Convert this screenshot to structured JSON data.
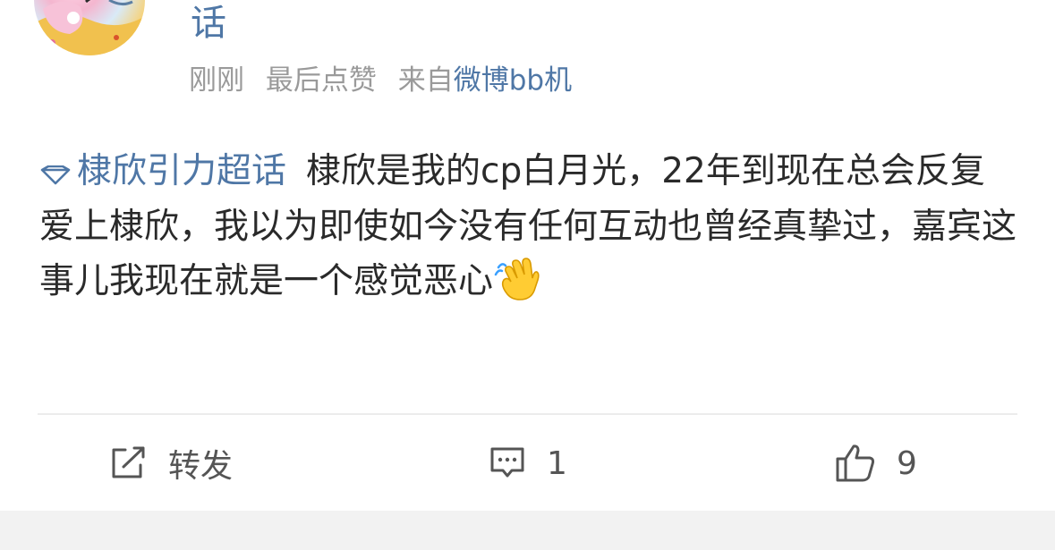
{
  "post": {
    "author": "话",
    "time": "刚刚",
    "status": "最后点赞",
    "source_prefix": "来自",
    "source": "微博bb机",
    "topic": "棣欣引力超话",
    "text": "棣欣是我的cp白月光，22年到现在总会反复爱上棣欣，我以为即使如今没有任何互动也曾经真挚过，嘉宾这事儿我现在就是一个感觉恶心",
    "emoji": "waving-hand"
  },
  "actions": {
    "repost_label": "转发",
    "comment_count": "1",
    "like_count": "9"
  },
  "colors": {
    "link": "#4f77a6",
    "meta": "#9a9a9a",
    "text": "#2a2a2a"
  }
}
